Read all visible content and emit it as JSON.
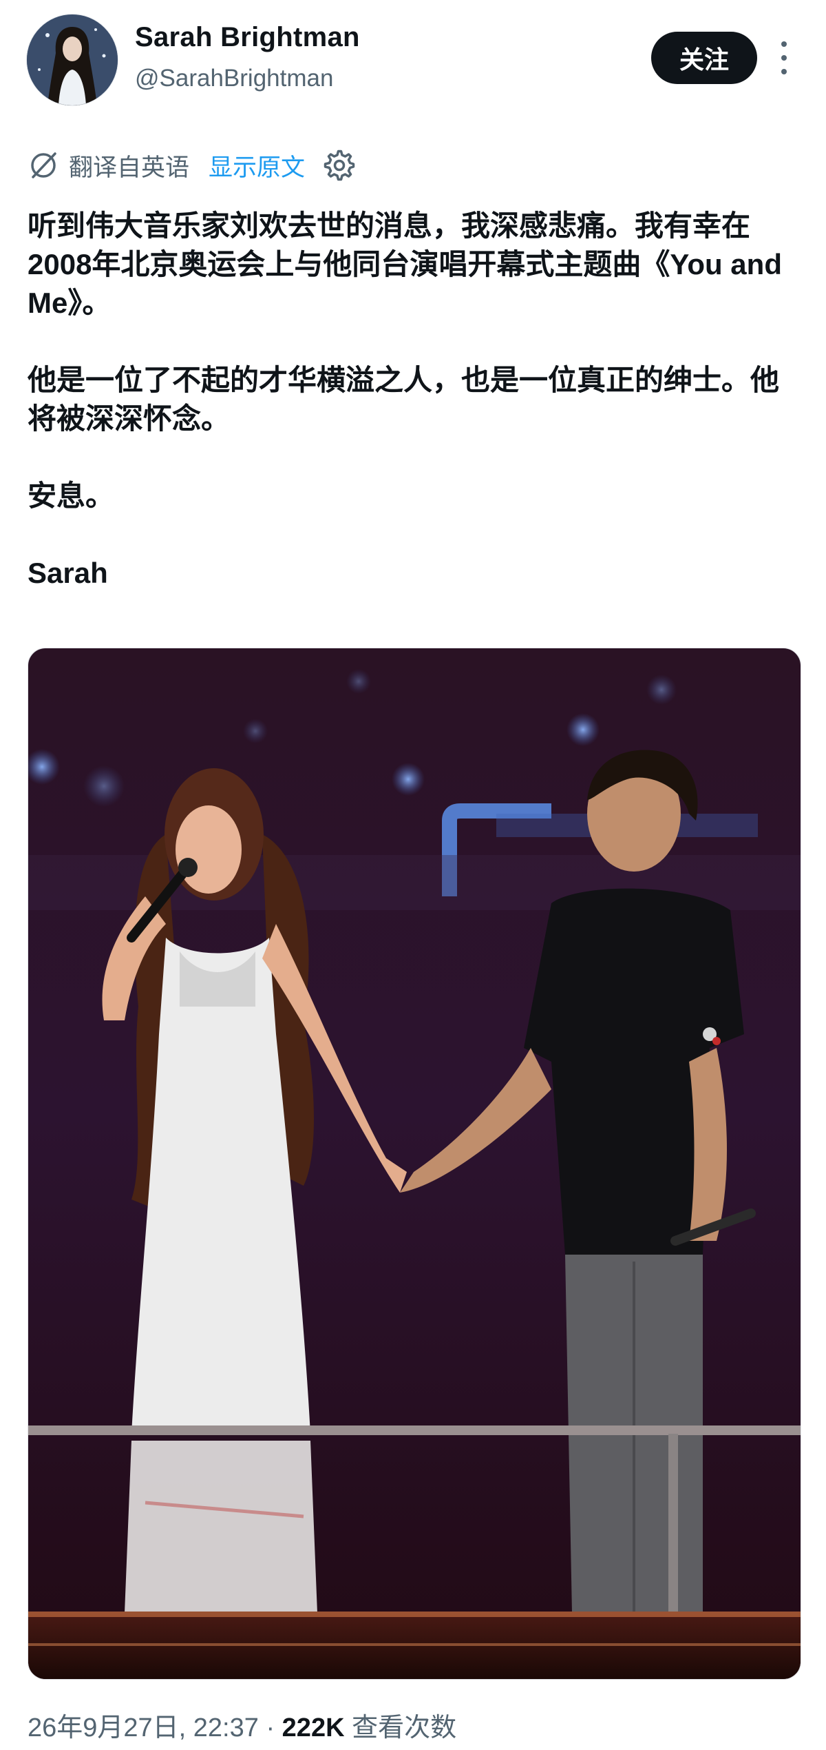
{
  "author": {
    "display_name": "Sarah Brightman",
    "handle": "@SarahBrightman",
    "avatar_icon": "profile-photo"
  },
  "header": {
    "follow_label": "关注",
    "more_icon": "more-vertical-icon"
  },
  "translation": {
    "label": "翻译自英语",
    "show_original": "显示原文",
    "translate_icon": "translate-icon",
    "settings_icon": "gear-icon"
  },
  "tweet": {
    "paragraphs": [
      "听到伟大音乐家刘欢去世的消息，我深感悲痛。我有幸在2008年北京奥运会上与他同台演唱开幕式主题曲《You and Me》。",
      "他是一位了不起的才华横溢之人，也是一位真正的绅士。他将被深深怀念。",
      "安息。",
      "Sarah"
    ]
  },
  "meta": {
    "timestamp": "26年9月27日, 22:37",
    "separator": "·",
    "views_count": "222K",
    "views_label": "查看次数"
  },
  "colors": {
    "text": "#0f1419",
    "secondary": "#536471",
    "link": "#1d9bf0",
    "button_bg": "#0f1419"
  }
}
